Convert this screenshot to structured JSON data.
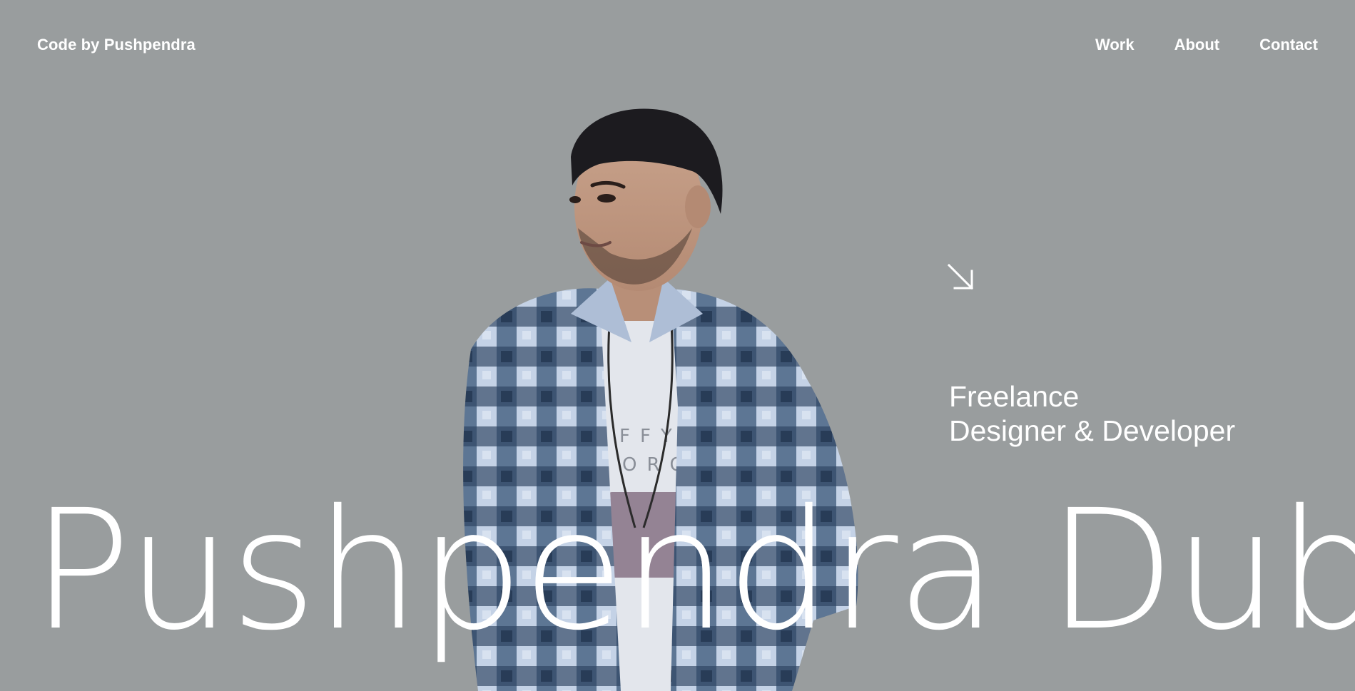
{
  "header": {
    "logo": "Code by Pushpendra",
    "nav": [
      {
        "label": "Work"
      },
      {
        "label": "About"
      },
      {
        "label": "Contact"
      }
    ]
  },
  "hero": {
    "arrow_icon": "arrow-down-right-icon",
    "tagline_line1": "Freelance",
    "tagline_line2": "Designer & Developer",
    "name": "Pushpendra Dubey"
  },
  "colors": {
    "background": "#999d9e",
    "text": "#ffffff",
    "shirt_dark": "#2f4560",
    "shirt_light": "#c9d6e8"
  }
}
